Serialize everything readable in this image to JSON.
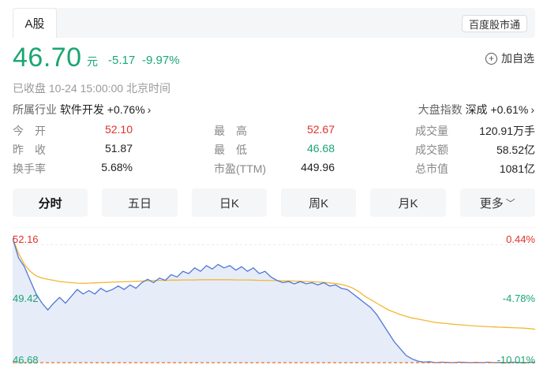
{
  "header": {
    "tab_label": "A股",
    "badge": "百度股市通"
  },
  "quote": {
    "price": "46.70",
    "unit": "元",
    "change": "-5.17",
    "change_pct": "-9.97%",
    "add_watch": "加自选",
    "status_label": "已收盘",
    "status_time": "10-24 15:00:00",
    "status_zone": "北京时间"
  },
  "industry": {
    "label": "所属行业",
    "name": "软件开发",
    "change": "+0.76%"
  },
  "market": {
    "label": "大盘指数",
    "name": "深成",
    "change": "+0.61%"
  },
  "stats": {
    "open_label": "今　开",
    "open": "52.10",
    "high_label": "最　高",
    "high": "52.67",
    "volume_label": "成交量",
    "volume": "120.91万手",
    "prev_label": "昨　收",
    "prev": "51.87",
    "low_label": "最　低",
    "low": "46.68",
    "amount_label": "成交额",
    "amount": "58.52亿",
    "turnover_label": "换手率",
    "turnover": "5.68%",
    "pe_label": "市盈(TTM)",
    "pe": "449.96",
    "mcap_label": "总市值",
    "mcap": "1081亿"
  },
  "colors": {
    "up": "#e2312a",
    "down": "#1aa672",
    "price_line": "#4f78d6",
    "avg_line": "#f2b736",
    "area_fill": "#e7ecf9"
  },
  "period_tabs": [
    "分时",
    "五日",
    "日K",
    "周K",
    "月K",
    "更多"
  ],
  "chart_data": {
    "type": "line",
    "y_left_labels": [
      "52.16",
      "49.42",
      "46.68"
    ],
    "y_right_labels": [
      "0.44%",
      "-4.78%",
      "-10.01%"
    ],
    "ylim": [
      46.68,
      52.16
    ],
    "prev_close": 51.87,
    "series": [
      {
        "values": [
          52.16,
          51.3,
          50.9,
          50.3,
          49.7,
          49.3,
          49.0,
          49.3,
          49.55,
          49.3,
          49.6,
          49.9,
          49.7,
          49.85,
          49.7,
          49.95,
          49.8,
          49.9,
          50.05,
          49.9,
          50.1,
          49.95,
          50.2,
          50.35,
          50.2,
          50.4,
          50.3,
          50.55,
          50.45,
          50.7,
          50.6,
          50.85,
          50.7,
          50.95,
          50.8,
          51.0,
          50.85,
          50.95,
          50.75,
          50.9,
          50.7,
          50.85,
          50.6,
          50.7,
          50.45,
          50.3,
          50.2,
          50.25,
          50.15,
          50.25,
          50.15,
          50.2,
          50.1,
          50.2,
          50.05,
          50.1,
          49.95,
          49.9,
          49.7,
          49.5,
          49.3,
          49.1,
          48.8,
          48.4,
          48.0,
          47.6,
          47.3,
          47.0,
          46.85,
          46.75,
          46.7,
          46.72,
          46.68,
          46.7,
          46.69,
          46.68,
          46.7,
          46.69,
          46.68,
          46.69,
          46.68,
          46.7,
          46.68,
          46.69,
          46.68,
          46.7,
          46.69,
          46.68,
          46.69,
          46.7
        ]
      },
      {
        "values": [
          52.16,
          51.5,
          51.0,
          50.7,
          50.5,
          50.4,
          50.35,
          50.3,
          50.25,
          50.22,
          50.2,
          50.18,
          50.17,
          50.18,
          50.19,
          50.2,
          50.21,
          50.22,
          50.23,
          50.24,
          50.25,
          50.26,
          50.27,
          50.28,
          50.29,
          50.3,
          50.3,
          50.31,
          50.31,
          50.32,
          50.32,
          50.32,
          50.33,
          50.33,
          50.33,
          50.33,
          50.33,
          50.33,
          50.32,
          50.32,
          50.32,
          50.31,
          50.3,
          50.3,
          50.29,
          50.29,
          50.28,
          50.28,
          50.27,
          50.26,
          50.25,
          50.24,
          50.23,
          50.21,
          50.19,
          50.16,
          50.12,
          50.05,
          49.95,
          49.8,
          49.6,
          49.45,
          49.3,
          49.15,
          49.0,
          48.9,
          48.8,
          48.72,
          48.65,
          48.6,
          48.55,
          48.5,
          48.45,
          48.42,
          48.4,
          48.37,
          48.35,
          48.33,
          48.31,
          48.29,
          48.28,
          48.26,
          48.25,
          48.24,
          48.23,
          48.22,
          48.21,
          48.2,
          48.18,
          48.15
        ]
      }
    ]
  }
}
